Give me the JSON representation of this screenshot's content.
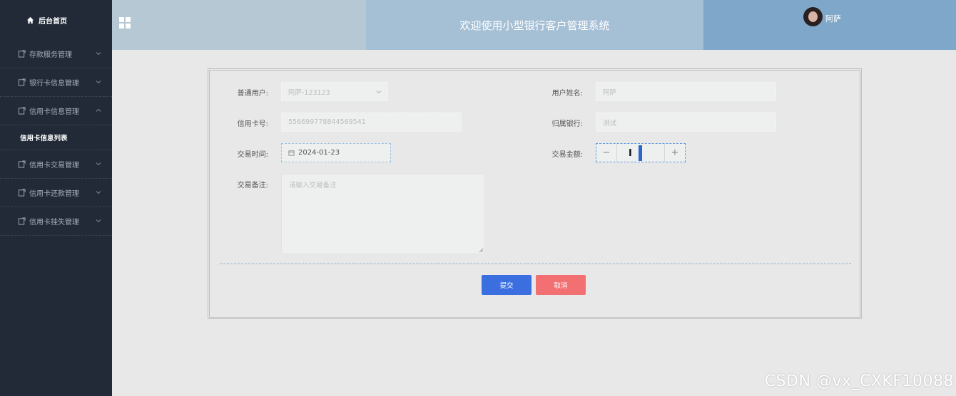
{
  "sidebar": {
    "home_label": "后台首页",
    "items": [
      {
        "label": "存款服务管理"
      },
      {
        "label": "银行卡信息管理"
      },
      {
        "label": "信用卡信息管理"
      },
      {
        "label": "信用卡交易管理"
      },
      {
        "label": "信用卡还款管理"
      },
      {
        "label": "信用卡挂失管理"
      }
    ],
    "sub_item": "信用卡信息列表"
  },
  "header": {
    "title": "欢迎使用小型银行客户管理系统",
    "username": "阿萨"
  },
  "form": {
    "user_label": "普通用户:",
    "user_value": "阿萨-123123",
    "name_label": "用户姓名:",
    "name_value": "阿萨",
    "card_label": "信用卡号:",
    "card_value": "556699778844569541",
    "bank_label": "归属银行:",
    "bank_value": "测试",
    "time_label": "交易时间:",
    "time_value": "2024-01-23",
    "amount_label": "交易金额:",
    "amount_minus": "−",
    "amount_plus": "+",
    "note_label": "交易备注:",
    "note_placeholder": "请输入交易备注",
    "submit_label": "提交",
    "cancel_label": "取消"
  },
  "watermark": "CSDN @vx_CXKF10088",
  "colors": {
    "sidebar_bg": "#222a38",
    "submit": "#3b6fe0",
    "cancel": "#f27072"
  }
}
